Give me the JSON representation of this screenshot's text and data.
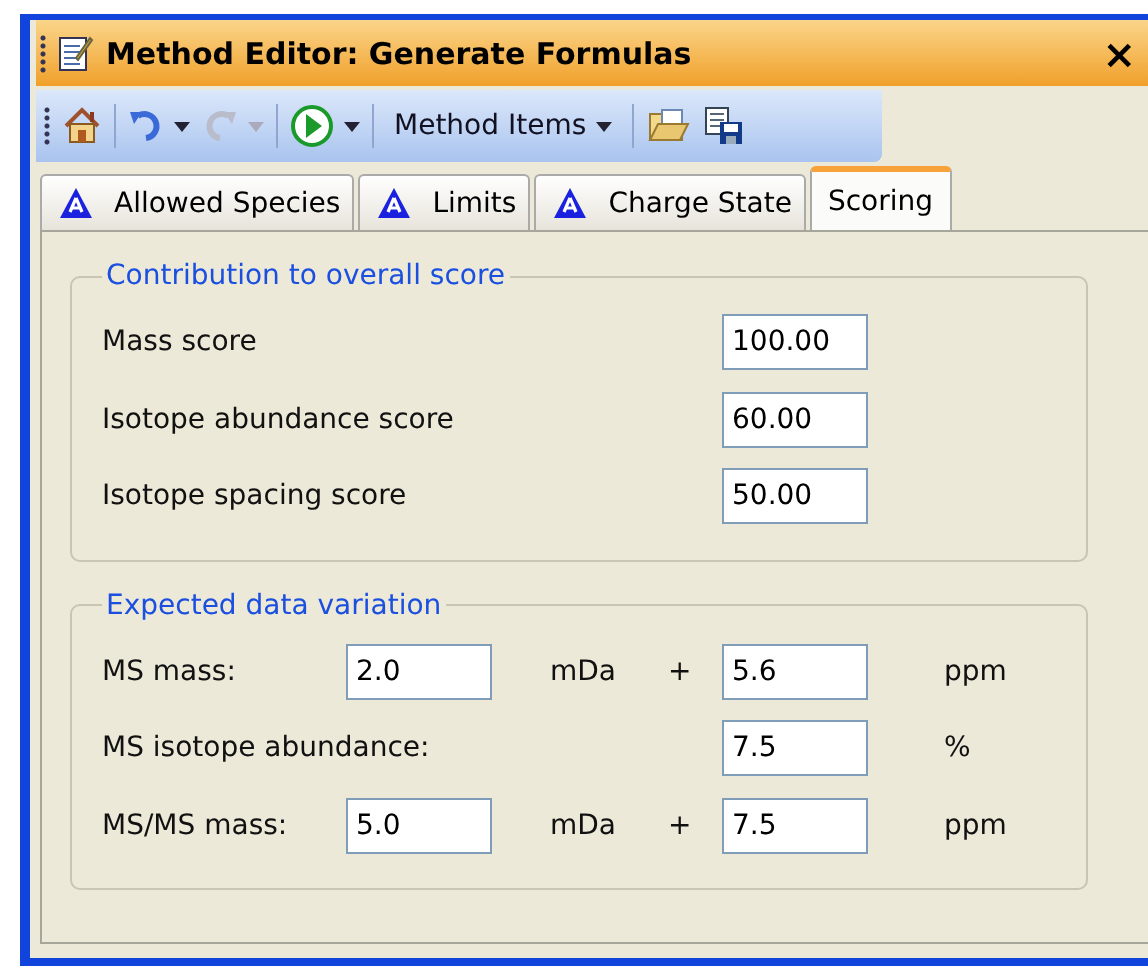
{
  "window": {
    "title": "Method Editor: Generate Formulas",
    "close": "×"
  },
  "toolbar": [
    {
      "kind": "home"
    },
    {
      "kind": "sep"
    },
    {
      "kind": "undo",
      "disabled": false,
      "dropdown": true
    },
    {
      "kind": "redo",
      "disabled": true,
      "dropdown": true
    },
    {
      "kind": "sep"
    },
    {
      "kind": "run",
      "dropdown": true
    },
    {
      "kind": "sep"
    },
    {
      "kind": "menu",
      "label": "Method Items",
      "dropdown": true
    },
    {
      "kind": "sep"
    },
    {
      "kind": "open"
    },
    {
      "kind": "save"
    }
  ],
  "tabs": [
    {
      "label": "Allowed Species",
      "selected": false,
      "icon": true
    },
    {
      "label": "Limits",
      "selected": false,
      "icon": true
    },
    {
      "label": "Charge State",
      "selected": false,
      "icon": true
    },
    {
      "label": "Scoring",
      "selected": true,
      "icon": false
    }
  ],
  "groups": [
    {
      "title": "Contribution to overall score",
      "rows": [
        {
          "kind": "single",
          "label": "Mass score",
          "value": "100.00"
        },
        {
          "kind": "single",
          "label": "Isotope abundance score",
          "value": "60.00"
        },
        {
          "kind": "single",
          "label": "Isotope spacing score",
          "value": "50.00"
        }
      ]
    },
    {
      "title": "Expected data variation",
      "rows": [
        {
          "kind": "range",
          "label": "MS mass:",
          "value_1": "2.0",
          "unit_1": "mDa",
          "operator": "+",
          "value_2": "5.6",
          "unit_2": "ppm"
        },
        {
          "kind": "single",
          "label": "MS isotope abundance:",
          "value": "7.5",
          "unit": "%"
        },
        {
          "kind": "range",
          "label": "MS/MS mass:",
          "value_1": "5.0",
          "unit_1": "mDa",
          "operator": "+",
          "value_2": "7.5",
          "unit_2": "ppm"
        }
      ]
    }
  ]
}
